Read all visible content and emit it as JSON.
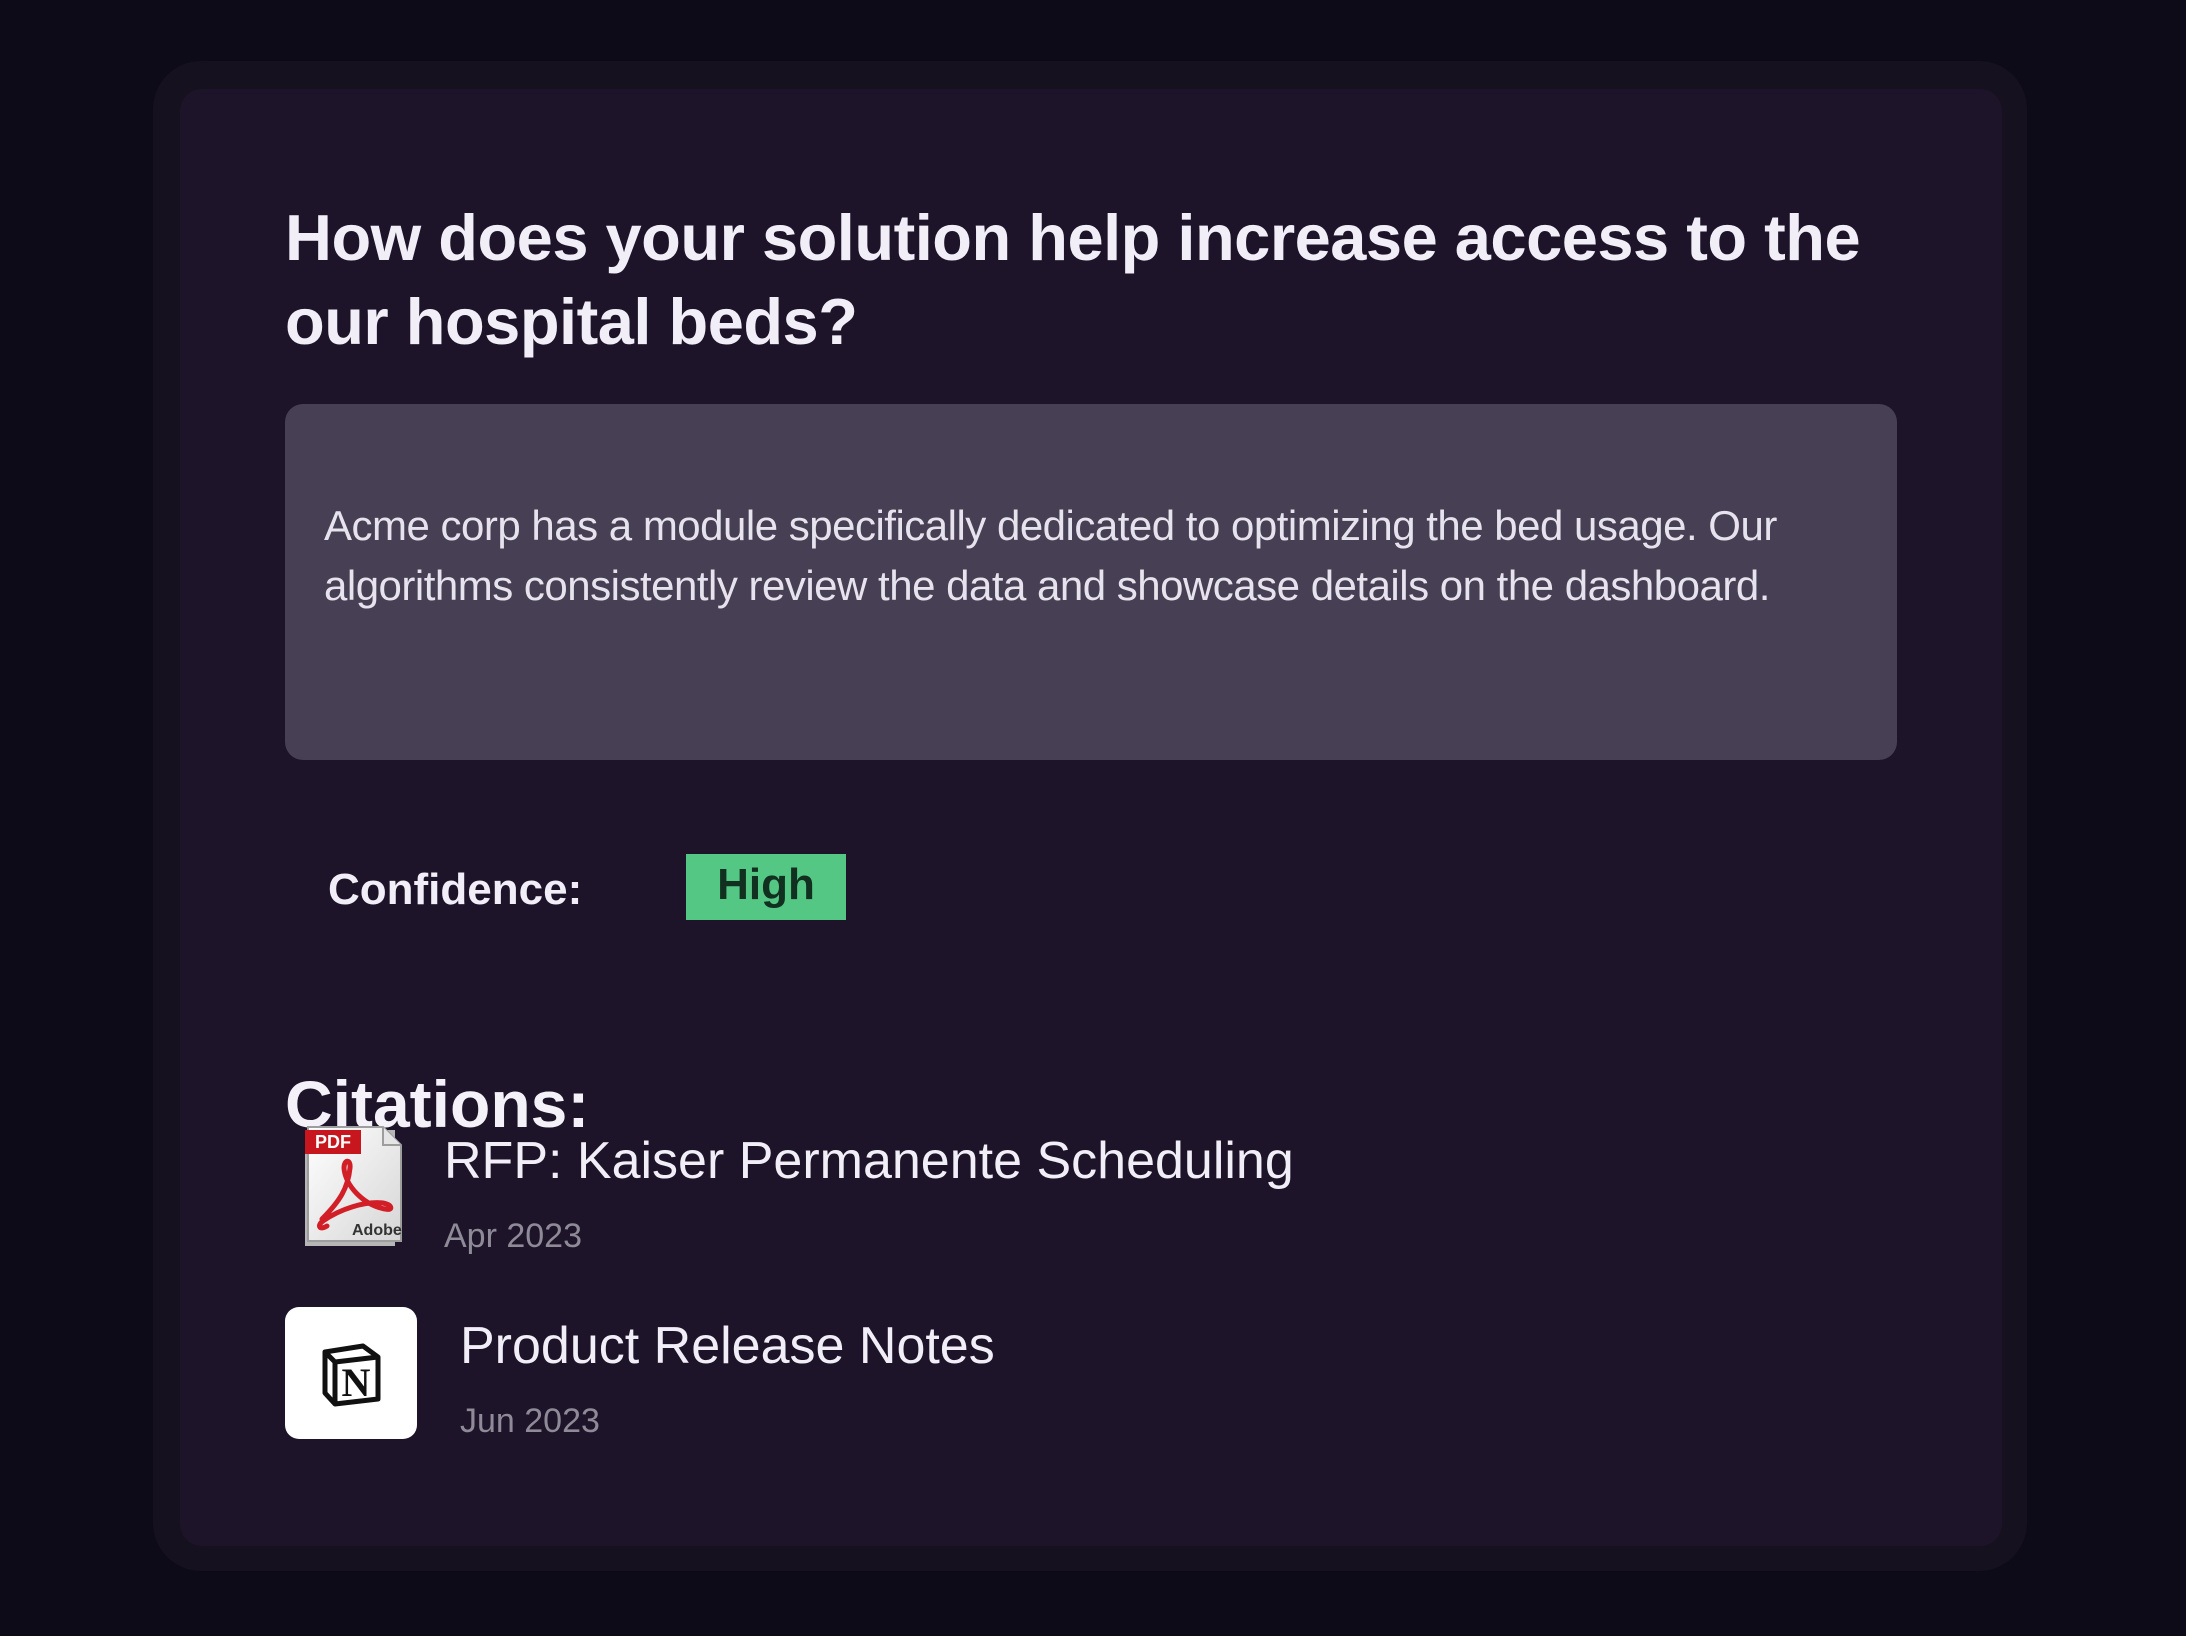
{
  "question": {
    "text": "How does your solution help increase access to the our hospital beds?"
  },
  "answer": {
    "text": "Acme corp has a module specifically dedicated to optimizing the bed usage. Our algorithms consistently review the data and showcase details on the dashboard."
  },
  "confidence": {
    "label": "Confidence:",
    "value": "High",
    "color": "#55c784"
  },
  "citations": {
    "title": "Citations:",
    "items": [
      {
        "icon": "pdf-icon",
        "icon_label": "PDF",
        "icon_brand": "Adobe",
        "title": "RFP: Kaiser Permanente Scheduling",
        "date": "Apr 2023"
      },
      {
        "icon": "notion-icon",
        "icon_letter": "N",
        "title": "Product Release Notes",
        "date": "Jun 2023"
      }
    ]
  },
  "colors": {
    "page_background": "#0d0b17",
    "card_background": "#1d1429",
    "answer_background": "#473f53",
    "primary_text": "#f1eef7",
    "secondary_text": "#8f8a98"
  }
}
